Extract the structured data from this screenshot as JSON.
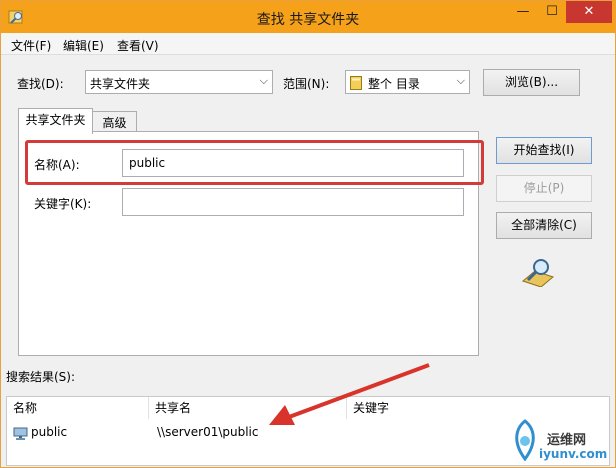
{
  "window": {
    "title": "查找 共享文件夹",
    "min_glyph": "—",
    "max_glyph": "☐",
    "close_glyph": "✕"
  },
  "menu": [
    "文件(F)",
    "编辑(E)",
    "查看(V)"
  ],
  "search": {
    "find_label": "查找(D):",
    "find_value": "共享文件夹",
    "scope_label": "范围(N):",
    "scope_value": "整个 目录",
    "browse_label": "浏览(B)..."
  },
  "tabs": [
    "共享文件夹",
    "高级"
  ],
  "form": {
    "name_label": "名称(A):",
    "name_value": "public",
    "keyword_label": "关键字(K):",
    "keyword_value": ""
  },
  "actions": {
    "start": "开始查找(I)",
    "stop": "停止(P)",
    "clear": "全部清除(C)"
  },
  "results": {
    "label": "搜索结果(S):",
    "columns": [
      "名称",
      "共享名",
      "关键字"
    ],
    "rows": [
      {
        "name": "public",
        "share": "\\\\server01\\public",
        "keyword": ""
      }
    ]
  },
  "watermark": {
    "cn": "运维网",
    "url": "iyunv.com"
  },
  "colors": {
    "titlebar": "#f6a11a",
    "highlight": "#d33a3a",
    "arrow": "#d9342b"
  }
}
